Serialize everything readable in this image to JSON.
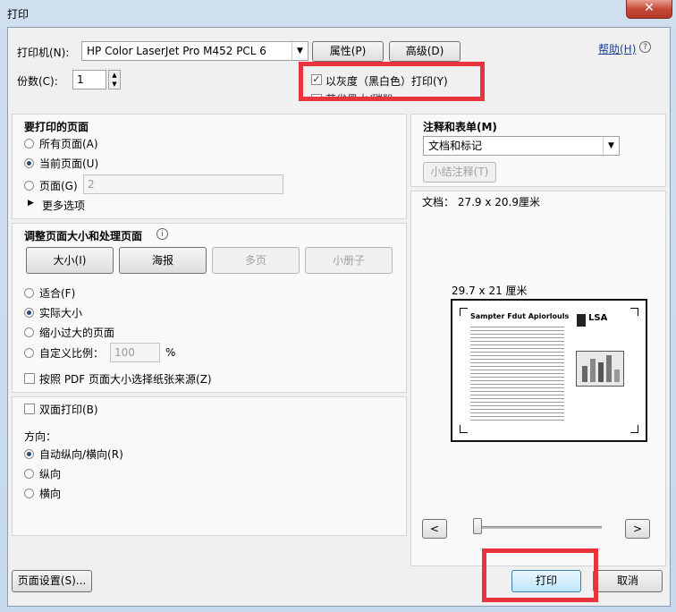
{
  "window": {
    "title": "打印",
    "close_glyph": "✕"
  },
  "printer": {
    "label": "打印机(N):",
    "selected": "HP Color LaserJet Pro M452 PCL 6",
    "properties_btn": "属性(P)",
    "advanced_btn": "高级(D)",
    "help_link": "帮助(H)",
    "copies_label": "份数(C):",
    "copies_value": "1",
    "grayscale_label": "以灰度（黑白色）打印(Y)",
    "grayscale_checked": true,
    "save_ink_label": "节省墨水/碳粉"
  },
  "pages": {
    "heading": "要打印的页面",
    "all": "所有页面(A)",
    "current": "当前页面(U)",
    "range": "页面(G)",
    "range_value": "2",
    "more": "更多选项"
  },
  "sizing": {
    "heading": "调整页面大小和处理页面",
    "tabs": [
      "大小(I)",
      "海报",
      "多页",
      "小册子"
    ],
    "fit": "适合(F)",
    "actual": "实际大小",
    "shrink": "缩小过大的页面",
    "custom": "自定义比例：",
    "custom_value": "100",
    "percent": "%",
    "paper_source": "按照 PDF 页面大小选择纸张来源(Z)"
  },
  "duplex": {
    "label": "双面打印(B)",
    "orientation_label": "方向：",
    "auto": "自动纵向/横向(R)",
    "portrait": "纵向",
    "landscape": "横向"
  },
  "comments": {
    "heading": "注释和表单(M)",
    "selected": "文档和标记",
    "summarize_btn": "小结注释(T)"
  },
  "preview": {
    "doc_size": "文档： 27.9 x 20.9厘米",
    "paper_size": "29.7 x 21 厘米",
    "sheet_title": "Sampter Fdut Apiorlouls",
    "sheet_logo": "LSA",
    "prev_btn": "<",
    "next_btn": ">",
    "slider_level": 0.0
  },
  "footer": {
    "page_setup_btn": "页面设置(S)...",
    "print_btn": "打印",
    "cancel_btn": "取消"
  },
  "colors": {
    "highlight": "#e8343c",
    "accent": "#1a3fa0"
  }
}
